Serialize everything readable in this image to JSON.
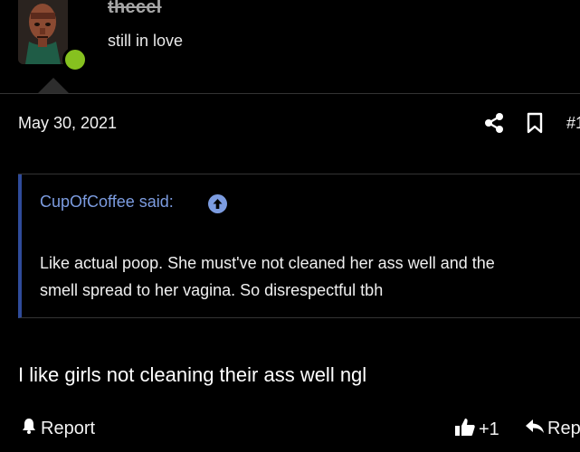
{
  "user": {
    "name": "thecel",
    "title": "still in love",
    "online_color": "#86c11f"
  },
  "post": {
    "date": "May 30, 2021",
    "number": "#1",
    "actions": [
      "share-icon",
      "bookmark-icon"
    ]
  },
  "quote": {
    "author": "CupOfCoffee said:",
    "lines": [
      "Like actual poop. She must've not cleaned her ass well and the",
      "smell spread to her vagina. So disrespectful tbh"
    ],
    "accent": "#7c9ce0"
  },
  "reply": {
    "text": "I like girls not cleaning their ass well ngl"
  },
  "footer": {
    "report_label": "Report",
    "like_count": "+1",
    "reply_label": "Rep"
  }
}
